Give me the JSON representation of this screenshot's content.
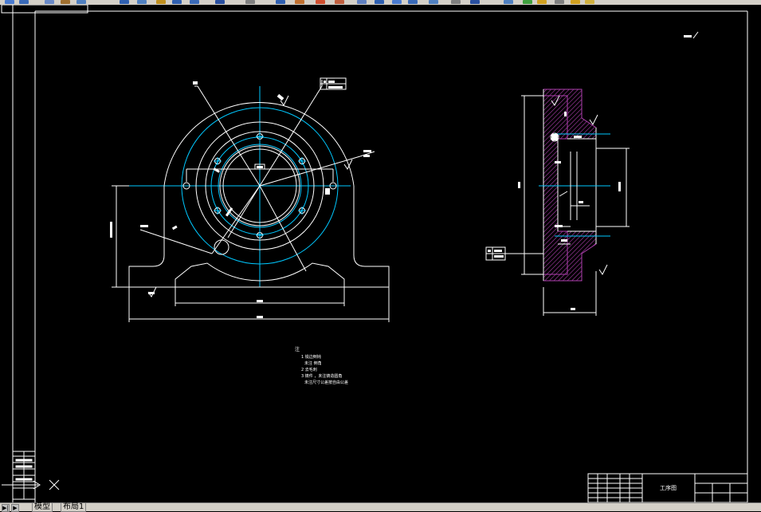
{
  "tabs": {
    "model": "模型",
    "layout": "布局1"
  },
  "title_block": {
    "name": "工序图"
  },
  "notes": {
    "heading": "注",
    "lines": [
      "1 锐边倒钝",
      "未注 倒角",
      "2 去毛刺",
      "3 铸件 ，未注铸造圆角",
      "未注尺寸公差按自由公差"
    ]
  },
  "colors": {
    "background": "#000000",
    "lines": "#ffffff",
    "center_lines": "#00c8ff",
    "hatch": "#b040b0",
    "toolbar": "#d4d0c8"
  },
  "icons": [
    "ucs-icon",
    "toolbar-icons"
  ]
}
